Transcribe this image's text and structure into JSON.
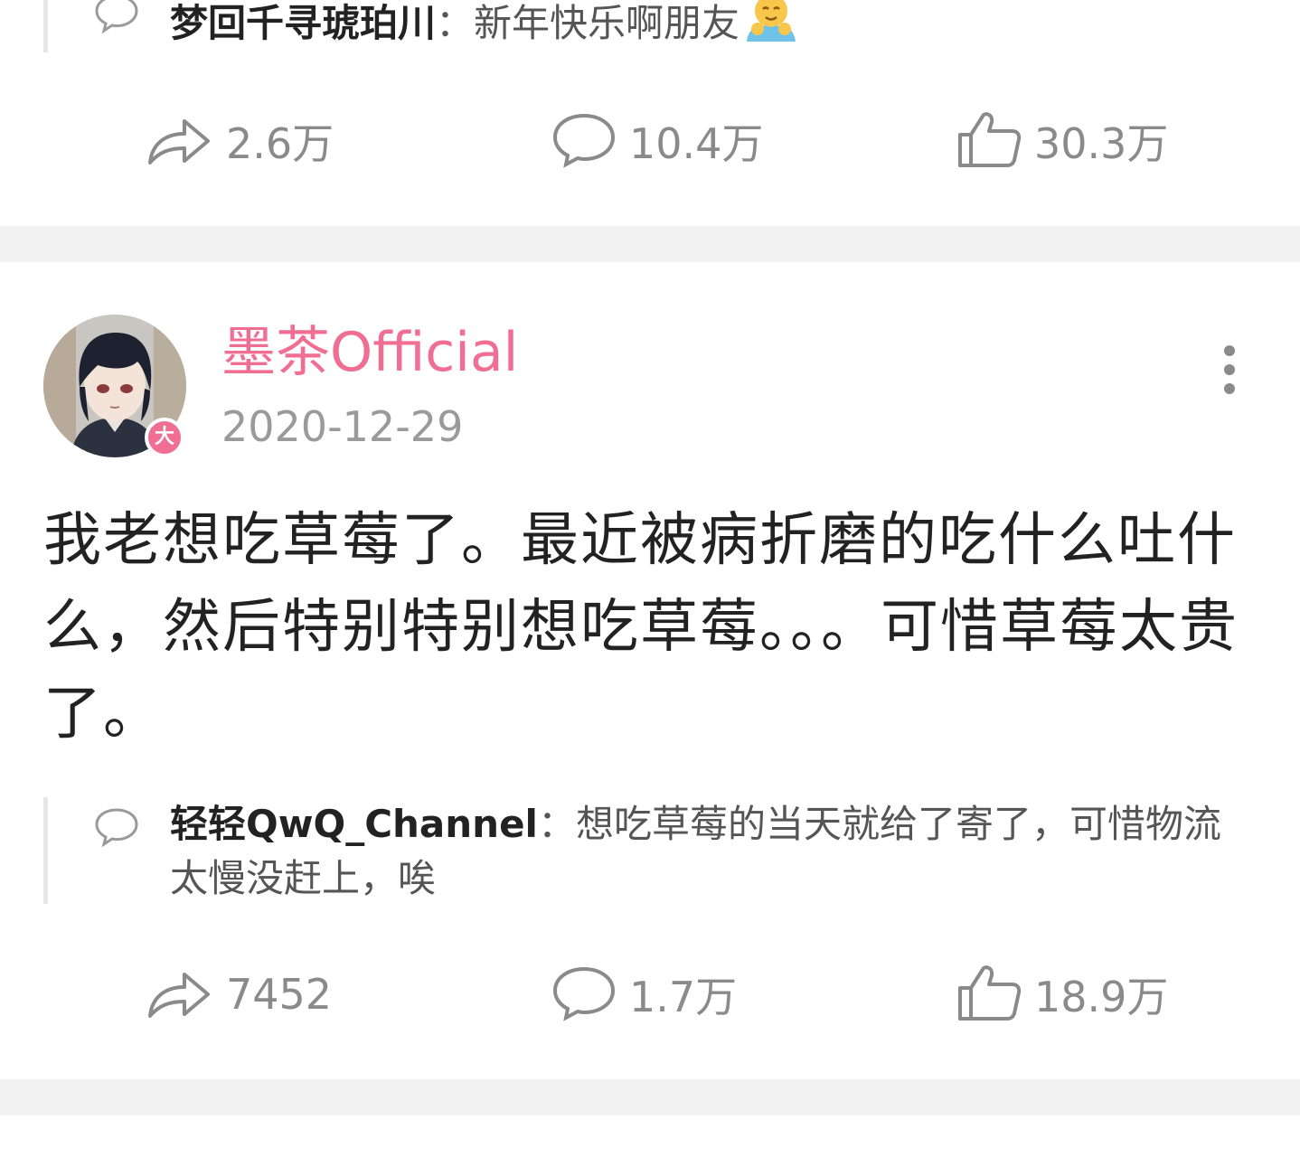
{
  "prev_post": {
    "reply": {
      "author": "梦回千寻琥珀川",
      "separator": "：",
      "text": "新年快乐啊朋友",
      "emoji": "hug-emoji"
    },
    "actions": {
      "share_count": "2.6万",
      "comment_count": "10.4万",
      "like_count": "30.3万"
    }
  },
  "post": {
    "author": "墨茶Official",
    "badge": "大",
    "date": "2020-12-29",
    "text": "我老想吃草莓了。最近被病折磨的吃什么吐什么，然后特别特别想吃草莓。。。可惜草莓太贵了。",
    "reply": {
      "author": "轻轻QwQ_Channel",
      "separator": "：",
      "text": "想吃草莓的当天就给了寄了，可惜物流太慢没赶上，唉"
    },
    "actions": {
      "share_count": "7452",
      "comment_count": "1.7万",
      "like_count": "18.9万"
    }
  },
  "colors": {
    "accent_pink": "#f06d93",
    "icon_gray": "#8a8a8a",
    "divider_gray": "#f1f1f1"
  }
}
